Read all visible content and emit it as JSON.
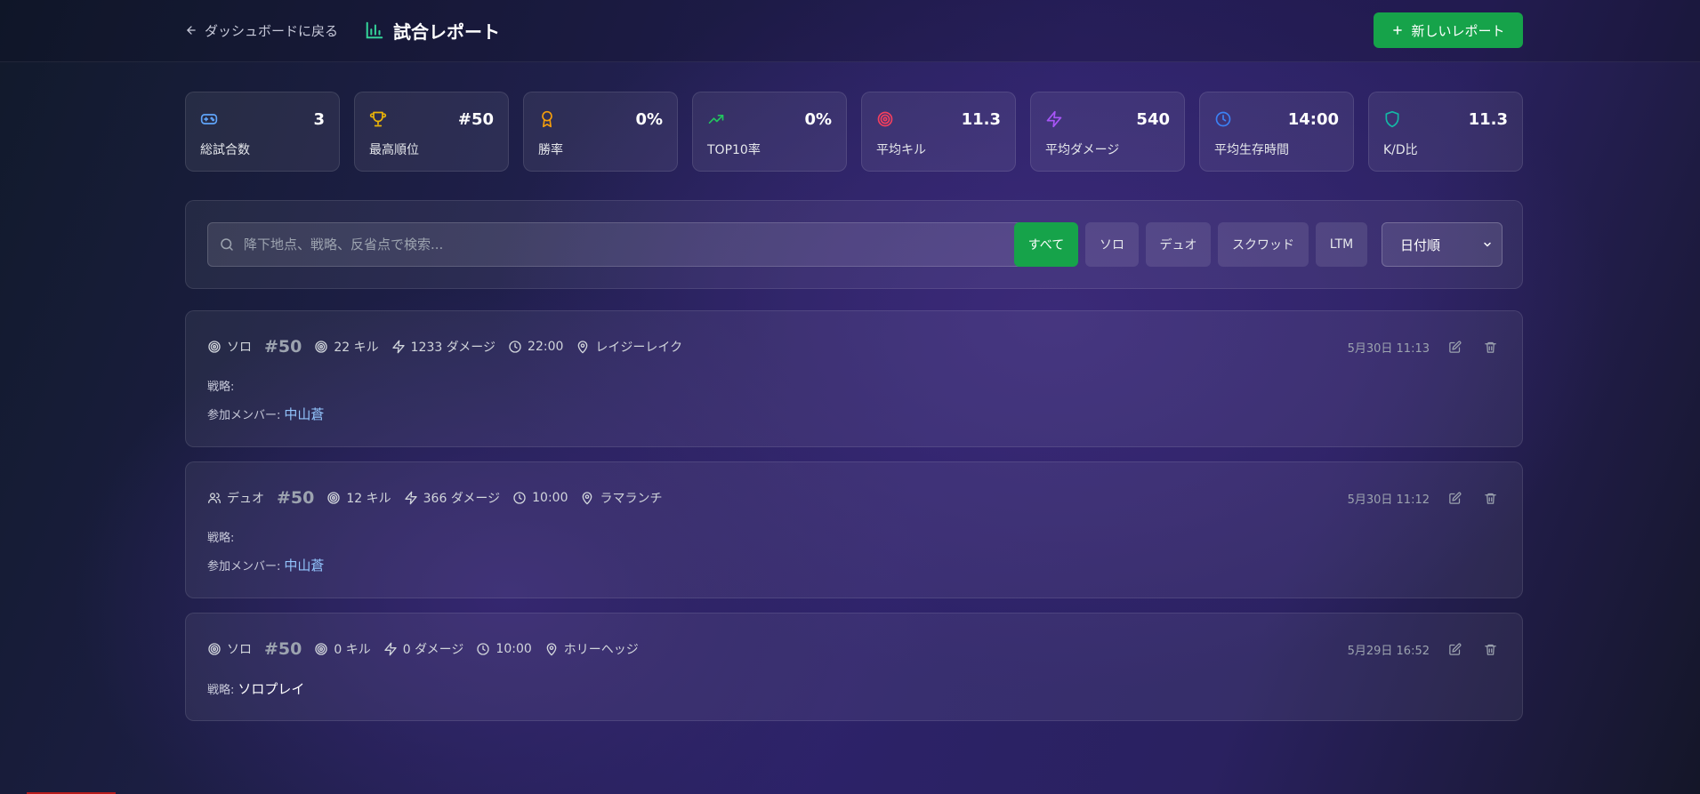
{
  "header": {
    "back_label": "ダッシュボードに戻る",
    "title": "試合レポート",
    "new_report_label": "新しいレポート"
  },
  "stats": [
    {
      "label": "総試合数",
      "value": "3",
      "icon": "gamepad-icon",
      "color": "#60a5fa"
    },
    {
      "label": "最高順位",
      "value": "#50",
      "icon": "trophy-icon",
      "color": "#eab308"
    },
    {
      "label": "勝率",
      "value": "0%",
      "icon": "award-icon",
      "color": "#f59e0b"
    },
    {
      "label": "TOP10率",
      "value": "0%",
      "icon": "trending-up-icon",
      "color": "#22c55e"
    },
    {
      "label": "平均キル",
      "value": "11.3",
      "icon": "target-icon",
      "color": "#f43f5e"
    },
    {
      "label": "平均ダメージ",
      "value": "540",
      "icon": "zap-icon",
      "color": "#a855f7"
    },
    {
      "label": "平均生存時間",
      "value": "14:00",
      "icon": "clock-icon",
      "color": "#3b82f6"
    },
    {
      "label": "K/D比",
      "value": "11.3",
      "icon": "shield-icon",
      "color": "#14b8a6"
    }
  ],
  "filters": {
    "search_placeholder": "降下地点、戦略、反省点で検索...",
    "modes": [
      "すべて",
      "ソロ",
      "デュオ",
      "スクワッド",
      "LTM"
    ],
    "active_mode": "すべて",
    "sort_label": "日付順"
  },
  "matches": [
    {
      "mode": "ソロ",
      "mode_icon": "target-icon",
      "rank": "#50",
      "kills": "22 キル",
      "damage": "1233 ダメージ",
      "time": "22:00",
      "location": "レイジーレイク",
      "date": "5月30日 11:13",
      "strategy_label": "戦略:",
      "strategy": "",
      "members_label": "参加メンバー:",
      "members": "中山蒼"
    },
    {
      "mode": "デュオ",
      "mode_icon": "users-icon",
      "rank": "#50",
      "kills": "12 キル",
      "damage": "366 ダメージ",
      "time": "10:00",
      "location": "ラマランチ",
      "date": "5月30日 11:12",
      "strategy_label": "戦略:",
      "strategy": "",
      "members_label": "参加メンバー:",
      "members": "中山蒼"
    },
    {
      "mode": "ソロ",
      "mode_icon": "target-icon",
      "rank": "#50",
      "kills": "0 キル",
      "damage": "0 ダメージ",
      "time": "10:00",
      "location": "ホリーヘッジ",
      "date": "5月29日 16:52",
      "strategy_label": "戦略:",
      "strategy": "ソロプレイ"
    }
  ],
  "colors": {
    "accent": "#16a34a",
    "member": "#93c5fd"
  }
}
